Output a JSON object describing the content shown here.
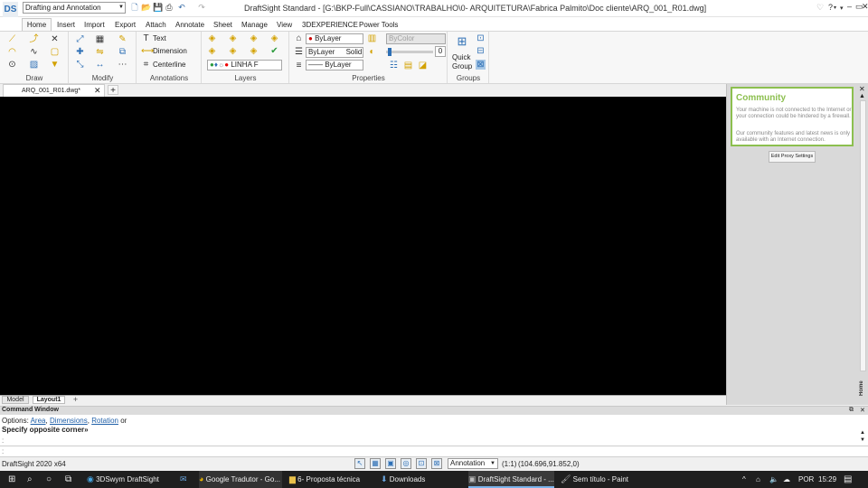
{
  "app": {
    "logo": "DS",
    "window_title": "DraftSight Standard - [G:\\BKP-Full\\CASSIANO\\TRABALHO\\0- ARQUITETURA\\Fabrica Palmito\\Doc cliente\\ARQ_001_R01.dwg]",
    "workspace": "Drafting and Annotation"
  },
  "ribbon_tabs": [
    "Home",
    "Insert",
    "Import",
    "Export",
    "Attach",
    "Annotate",
    "Sheet",
    "Manage",
    "View",
    "3DEXPERIENCE",
    "Power Tools"
  ],
  "panels": {
    "draw": "Draw",
    "modify": "Modify",
    "annotations": "Annotations",
    "layers": "Layers",
    "properties": "Properties",
    "groups": "Groups"
  },
  "annotations": {
    "text": "Text",
    "dimension": "Dimension",
    "centerline": "Centerline"
  },
  "layers": {
    "current": "LINHA F"
  },
  "properties": {
    "color": "ByLayer",
    "linestyle": "ByLayer",
    "linestyle_type": "Solid",
    "lineweight": "ByLayer",
    "bycolor": "ByColor",
    "transparency": "0"
  },
  "groups": {
    "quick_group_line1": "Quick",
    "quick_group_line2": "Group"
  },
  "doc_tab": {
    "name": "ARQ_001_R01.dwg*"
  },
  "layout_tabs": [
    "Model",
    "Layout1"
  ],
  "community": {
    "title": "Community",
    "msg1": "Your machine is not connected to the Internet or your connection could be hindered by a firewall.",
    "msg2": "Our community features and latest news is only available with an Internet connection.",
    "proxy_button": "Edit Proxy Settings",
    "side_tab": "Home"
  },
  "command": {
    "title": "Command Window",
    "options_prefix": "Options: ",
    "opt_area": "Area",
    "opt_dimensions": "Dimensions",
    "opt_rotation": "Rotation",
    "opt_or": " or",
    "prompt": "Specify opposite corner»",
    "input_prompt": ":"
  },
  "status": {
    "version": "DraftSight 2020 x64",
    "annotation": "Annotation",
    "scale": "(1:1)",
    "coords": "(104.696,91.852,0)"
  },
  "taskbar": {
    "items": [
      "3DSwym DraftSight",
      "Google Tradutor - Go...",
      "6- Proposta técnica",
      "Downloads",
      "DraftSight Standard - ...",
      "Sem título - Paint"
    ],
    "lang": "POR",
    "time": "15:29"
  }
}
